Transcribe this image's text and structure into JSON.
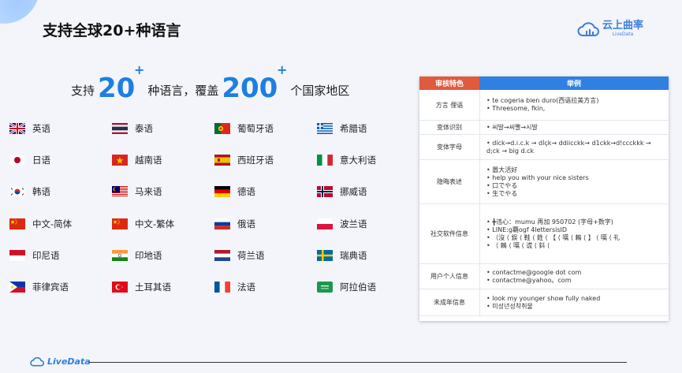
{
  "page": {
    "title": "支持全球20+种语言",
    "logo_cn": "云上曲率",
    "logo_en": "LiveData"
  },
  "headline": {
    "prefix": "支持",
    "num1": "20",
    "plus1": "+",
    "mid": "种语言，覆盖",
    "num2": "200",
    "plus2": "+",
    "suffix": "个国家地区"
  },
  "languages": [
    {
      "name": "英语",
      "flag": "flag-uk-icon"
    },
    {
      "name": "泰语",
      "flag": "flag-thailand-icon"
    },
    {
      "name": "葡萄牙语",
      "flag": "flag-portugal-icon"
    },
    {
      "name": "希腊语",
      "flag": "flag-greece-icon"
    },
    {
      "name": "日语",
      "flag": "flag-japan-icon"
    },
    {
      "name": "越南语",
      "flag": "flag-vietnam-icon"
    },
    {
      "name": "西班牙语",
      "flag": "flag-spain-icon"
    },
    {
      "name": "意大利语",
      "flag": "flag-italy-icon"
    },
    {
      "name": "韩语",
      "flag": "flag-korea-icon"
    },
    {
      "name": "马来语",
      "flag": "flag-malaysia-icon"
    },
    {
      "name": "德语",
      "flag": "flag-germany-icon"
    },
    {
      "name": "挪威语",
      "flag": "flag-norway-icon"
    },
    {
      "name": "中文-简体",
      "flag": "flag-china-icon"
    },
    {
      "name": "中文-繁体",
      "flag": "flag-china-icon"
    },
    {
      "name": "俄语",
      "flag": "flag-russia-icon"
    },
    {
      "name": "波兰语",
      "flag": "flag-poland-icon"
    },
    {
      "name": "印尼语",
      "flag": "flag-indonesia-icon"
    },
    {
      "name": "印地语",
      "flag": "flag-india-icon"
    },
    {
      "name": "荷兰语",
      "flag": "flag-netherlands-icon"
    },
    {
      "name": "瑞典语",
      "flag": "flag-sweden-icon"
    },
    {
      "name": "菲律宾语",
      "flag": "flag-philippines-icon"
    },
    {
      "name": "土耳其语",
      "flag": "flag-turkey-icon"
    },
    {
      "name": "法语",
      "flag": "flag-france-icon"
    },
    {
      "name": "阿拉伯语",
      "flag": "flag-saudi-icon"
    }
  ],
  "table": {
    "header_category": "审核特色",
    "header_example": "举例",
    "rows": [
      {
        "category": "方言 俚语",
        "examples": [
          "te cogeria bien duro(西语拉美方言)",
          "Threesome, fkin,"
        ]
      },
      {
        "category": "变体识别",
        "examples": [
          "씨발→씨빨→시발"
        ]
      },
      {
        "category": "变体字母",
        "examples": [
          "dick→d.i.c.k → dĺçk→ ddiicckk→ d1ckk→d!ccckkk →",
          "d;ck → big d.ck"
        ]
      },
      {
        "category": "隐晦表述",
        "examples": [
          "嚣大活好",
          "help you with your nice sisters",
          "口でやる",
          "生でやる"
        ]
      },
      {
        "category": "社交软件信息",
        "examples": [
          "╋违心：mumu 再加 950702 (字母+数字)",
          "LINE:g覇ogf 4lettersisID",
          "（沒 ⟨ 鋘 ⟨ 鞋 ⟨ 鉎 ⟨ 【 ⟨ 嚆 ⟨ 鵣 ⟨ 】 ⟨ 嚆 ⟨ 礼",
          "（ 鵣 ⟨ 嚆 ⟨ 谎 ⟨ 鈄 ⟨"
        ]
      },
      {
        "category": "用户个人信息",
        "examples": [
          "contactme@google dot com",
          "contactme@yahoo。com"
        ]
      },
      {
        "category": "未成年信息",
        "examples": [
          "look my younger show fully naked",
          "미성년성착취물"
        ]
      }
    ]
  },
  "footer": {
    "brand": "LiveData"
  }
}
